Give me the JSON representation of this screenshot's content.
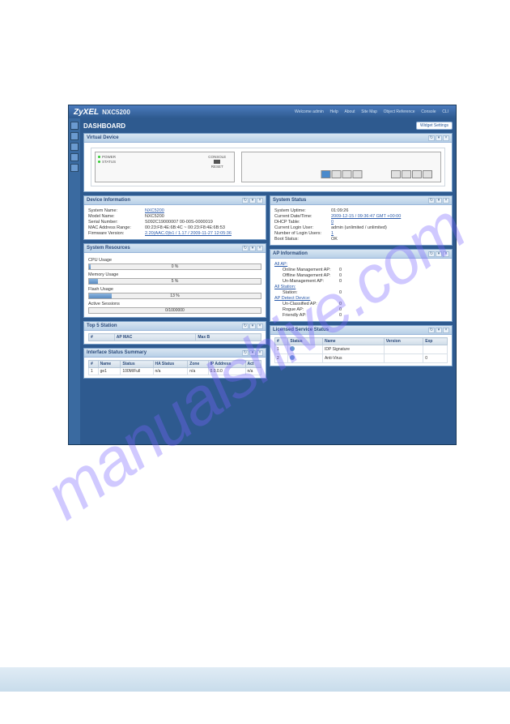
{
  "watermark": "manualshive.com",
  "brand": "ZyXEL",
  "model": "NXC5200",
  "toplinks": [
    "Welcome admin",
    "Help",
    "About",
    "Site Map",
    "Object Reference",
    "Console",
    "CLI"
  ],
  "dashboard_title": "DASHBOARD",
  "widget_btn": "Widget Settings",
  "panels": {
    "virtual": "Virtual Device",
    "devinfo": "Device Information",
    "sysres": "System Resources",
    "top5": "Top 5 Station",
    "ifsum": "Interface Status Summary",
    "sysstat": "System Status",
    "apinfo": "AP Information",
    "lic": "Licensed Service Status"
  },
  "devinfo": {
    "r1l": "System Name:",
    "r1v": "NXC5200",
    "r2l": "Model Name:",
    "r2v": "NXC5200",
    "r3l": "Serial Number:",
    "r3v": "S092C19000007 00-00S-0000019",
    "r4l": "MAC Address Range:",
    "r4v": "00:23:F8:4E:6B:4C ~ 00:23:F8:4E:6B:53",
    "r5l": "Firmware Version:",
    "r5v": "2.20(AAC.0)b1 / 1.17 / 2009-11-27 12:05:36"
  },
  "sysres": {
    "cpu_l": "CPU Usage",
    "cpu_v": "0 %",
    "mem_l": "Memory Usage",
    "mem_v": "5 %",
    "flash_l": "Flash Usage",
    "flash_v": "13 %",
    "sess_l": "Active Sessions",
    "sess_v": "0/1000000"
  },
  "top5": {
    "c1": "#",
    "c2": "AP MAC",
    "c3": "Max B"
  },
  "ifsum": {
    "c1": "#",
    "c2": "Name",
    "c3": "Status",
    "c4": "HA Status",
    "c5": "Zone",
    "c6": "IP Address",
    "c7": "Act",
    "r": [
      "1",
      "ge1",
      "100M/Full",
      "n/a",
      "n/a",
      "0.0.0.0",
      "n/a"
    ]
  },
  "sysstat": {
    "r1l": "System Uptime:",
    "r1v": "01:09:26",
    "r2l": "Current Date/Time:",
    "r2v": "2009-12-15 / 09:36:47 GMT +00:00",
    "r3l": "DHCP Table:",
    "r3v": "0",
    "r4l": "Current Login User:",
    "r4v": "admin (unlimited / unlimited)",
    "r5l": "Number of Login Users:",
    "r5v": "1",
    "r6l": "Boot Status:",
    "r6v": "OK"
  },
  "apinfo": {
    "g1": "All AP:",
    "r1l": "Online Management AP:",
    "r1v": "0",
    "r2l": "Offline Management AP:",
    "r2v": "0",
    "r3l": "Un-Management AP:",
    "r3v": "0",
    "g2": "All Station:",
    "r4l": "Station:",
    "r4v": "0",
    "g3": "AP Detect Device:",
    "r5l": "Un-Classified AP:",
    "r5v": "0",
    "r6l": "Rogue AP:",
    "r6v": "0",
    "r7l": "Friendly AP:",
    "r7v": "0"
  },
  "lic": {
    "c1": "#",
    "c2": "Status",
    "c3": "Name",
    "c4": "Version",
    "c5": "Exp",
    "r1": [
      "1",
      "",
      "IDP Signature",
      "",
      ""
    ],
    "r2": [
      "2",
      "",
      "Anti-Virus",
      "",
      "0"
    ]
  },
  "vd": {
    "power": "POWER",
    "status": "STATUS",
    "console": "CONSOLE",
    "reset": "RESET"
  }
}
